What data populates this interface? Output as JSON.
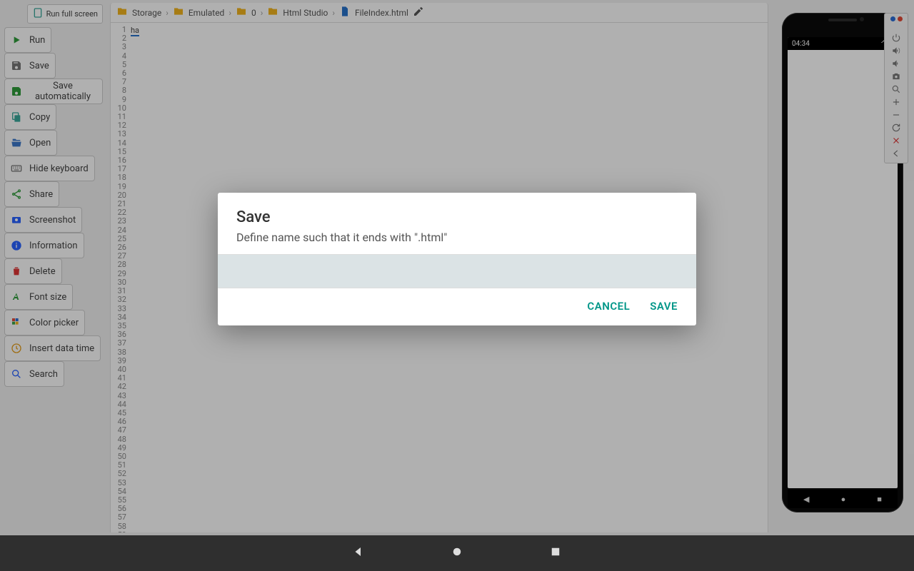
{
  "sidebar": {
    "runFullScreen": "Run full screen",
    "items": [
      {
        "icon": "play-icon",
        "label": "Run",
        "color": "ic-green"
      },
      {
        "icon": "save-icon",
        "label": "Save",
        "color": "ic-gray"
      },
      {
        "icon": "autosave-icon",
        "label": "Save automatically",
        "color": "ic-green"
      },
      {
        "icon": "copy-icon",
        "label": "Copy",
        "color": "ic-teal"
      },
      {
        "icon": "open-icon",
        "label": "Open",
        "color": "ic-blue2"
      },
      {
        "icon": "keyboard-icon",
        "label": "Hide keyboard",
        "color": "ic-gray"
      },
      {
        "icon": "share-icon",
        "label": "Share",
        "color": "ic-green"
      },
      {
        "icon": "screenshot-icon",
        "label": "Screenshot",
        "color": "ic-blue"
      },
      {
        "icon": "info-icon",
        "label": "Information",
        "color": "ic-blue"
      },
      {
        "icon": "delete-icon",
        "label": "Delete",
        "color": "ic-red"
      },
      {
        "icon": "fontsize-icon",
        "label": "Font size",
        "color": "ic-green"
      },
      {
        "icon": "palette-icon",
        "label": "Color picker",
        "color": ""
      },
      {
        "icon": "clock-icon",
        "label": "Insert data time",
        "color": "ic-orange"
      },
      {
        "icon": "search-icon",
        "label": "Search",
        "color": "ic-blue"
      }
    ]
  },
  "breadcrumbs": [
    "Storage",
    "Emulated",
    "0",
    "Html Studio",
    "FileIndex.html"
  ],
  "editor": {
    "lineCount": 59,
    "content": "ha"
  },
  "preview": {
    "statusTime": "04:34"
  },
  "dialog": {
    "title": "Save",
    "description": "Define name such that it ends with \".html\"",
    "value": "",
    "cancel": "CANCEL",
    "save": "SAVE"
  },
  "toolstrip": {
    "dots": [
      "#2a6cd6",
      "#e04836"
    ],
    "buttons": [
      "power-icon",
      "volume-up-icon",
      "volume-down-icon",
      "camera-icon",
      "zoom-icon",
      "plus-icon",
      "minus-icon",
      "refresh-icon",
      "close-icon",
      "back-icon"
    ]
  }
}
